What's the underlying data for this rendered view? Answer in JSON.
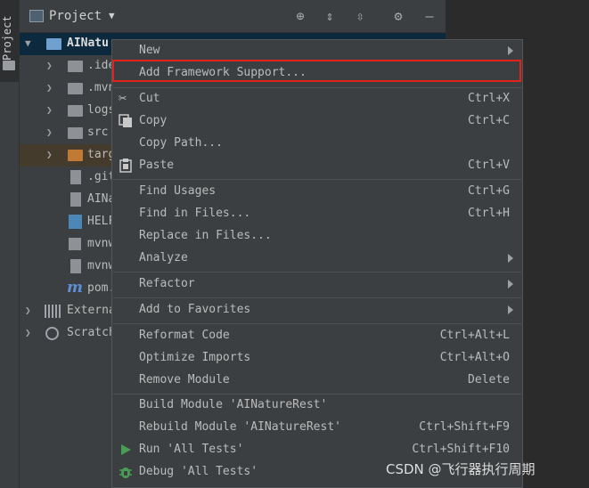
{
  "stripe": {
    "tab_label": "Project"
  },
  "project_panel": {
    "title": "Project",
    "tree": [
      {
        "label": "AINatu",
        "expanded": true,
        "selected": true,
        "kind": "module"
      },
      {
        "label": ".ide",
        "kind": "folder"
      },
      {
        "label": ".mvn",
        "kind": "folder"
      },
      {
        "label": "logs",
        "kind": "folder"
      },
      {
        "label": "src",
        "kind": "folder"
      },
      {
        "label": "targ",
        "kind": "folder-excluded"
      },
      {
        "label": ".git",
        "kind": "file"
      },
      {
        "label": "AINa",
        "kind": "file"
      },
      {
        "label": "HELF",
        "kind": "file"
      },
      {
        "label": "mvnw",
        "kind": "file"
      },
      {
        "label": "mvnw",
        "kind": "file"
      },
      {
        "label": "pom.",
        "kind": "maven"
      },
      {
        "label": "Externa",
        "kind": "libraries"
      },
      {
        "label": "Scratch",
        "kind": "scratches"
      }
    ]
  },
  "context_menu": {
    "items": [
      {
        "label": "New",
        "shortcut": "",
        "submenu": true
      },
      {
        "label": "Add Framework Support...",
        "shortcut": "",
        "highlighted": true
      },
      {
        "label": "Cut",
        "shortcut": "Ctrl+X",
        "icon": "scissors-icon"
      },
      {
        "label": "Copy",
        "shortcut": "Ctrl+C",
        "icon": "copy-icon"
      },
      {
        "label": "Copy Path...",
        "shortcut": ""
      },
      {
        "label": "Paste",
        "shortcut": "Ctrl+V",
        "icon": "clipboard-icon"
      },
      {
        "label": "Find Usages",
        "shortcut": "Ctrl+G"
      },
      {
        "label": "Find in Files...",
        "shortcut": "Ctrl+H"
      },
      {
        "label": "Replace in Files...",
        "shortcut": ""
      },
      {
        "label": "Analyze",
        "shortcut": "",
        "submenu": true
      },
      {
        "label": "Refactor",
        "shortcut": "",
        "submenu": true
      },
      {
        "label": "Add to Favorites",
        "shortcut": "",
        "submenu": true
      },
      {
        "label": "Reformat Code",
        "shortcut": "Ctrl+Alt+L"
      },
      {
        "label": "Optimize Imports",
        "shortcut": "Ctrl+Alt+O"
      },
      {
        "label": "Remove Module",
        "shortcut": "Delete"
      },
      {
        "label": "Build Module 'AINatureRest'",
        "shortcut": ""
      },
      {
        "label": "Rebuild Module 'AINatureRest'",
        "shortcut": "Ctrl+Shift+F9"
      },
      {
        "label": "Run 'All Tests'",
        "shortcut": "Ctrl+Shift+F10",
        "icon": "run-icon"
      },
      {
        "label": "Debug 'All Tests'",
        "shortcut": "",
        "icon": "debug-icon"
      }
    ]
  },
  "watermark": "CSDN @飞行器执行周期",
  "colors": {
    "highlight_border": "#e3221c",
    "selection": "#0d293e"
  }
}
